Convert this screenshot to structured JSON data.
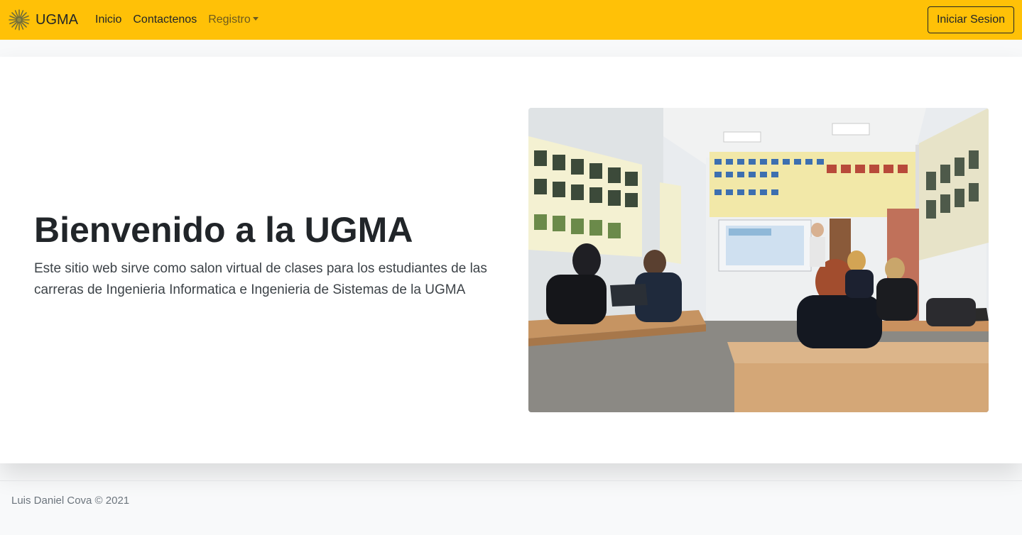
{
  "navbar": {
    "brand_logo_icon": "sunburst-logo-icon",
    "brand": "UGMA",
    "links": [
      {
        "label": "Inicio"
      },
      {
        "label": "Contactenos"
      }
    ],
    "dropdown": {
      "label": "Registro",
      "icon": "caret-down-icon"
    },
    "login_label": "Iniciar Sesion",
    "color": "#ffc107"
  },
  "hero": {
    "title": "Bienvenido a la UGMA",
    "lead": "Este sitio web sirve como salon virtual de clases para los estudiantes de las carreras de Ingenieria Informatica e Ingenieria de Sistemas de la UGMA"
  },
  "footer": {
    "text": "Luis Daniel Cova © 2021"
  }
}
